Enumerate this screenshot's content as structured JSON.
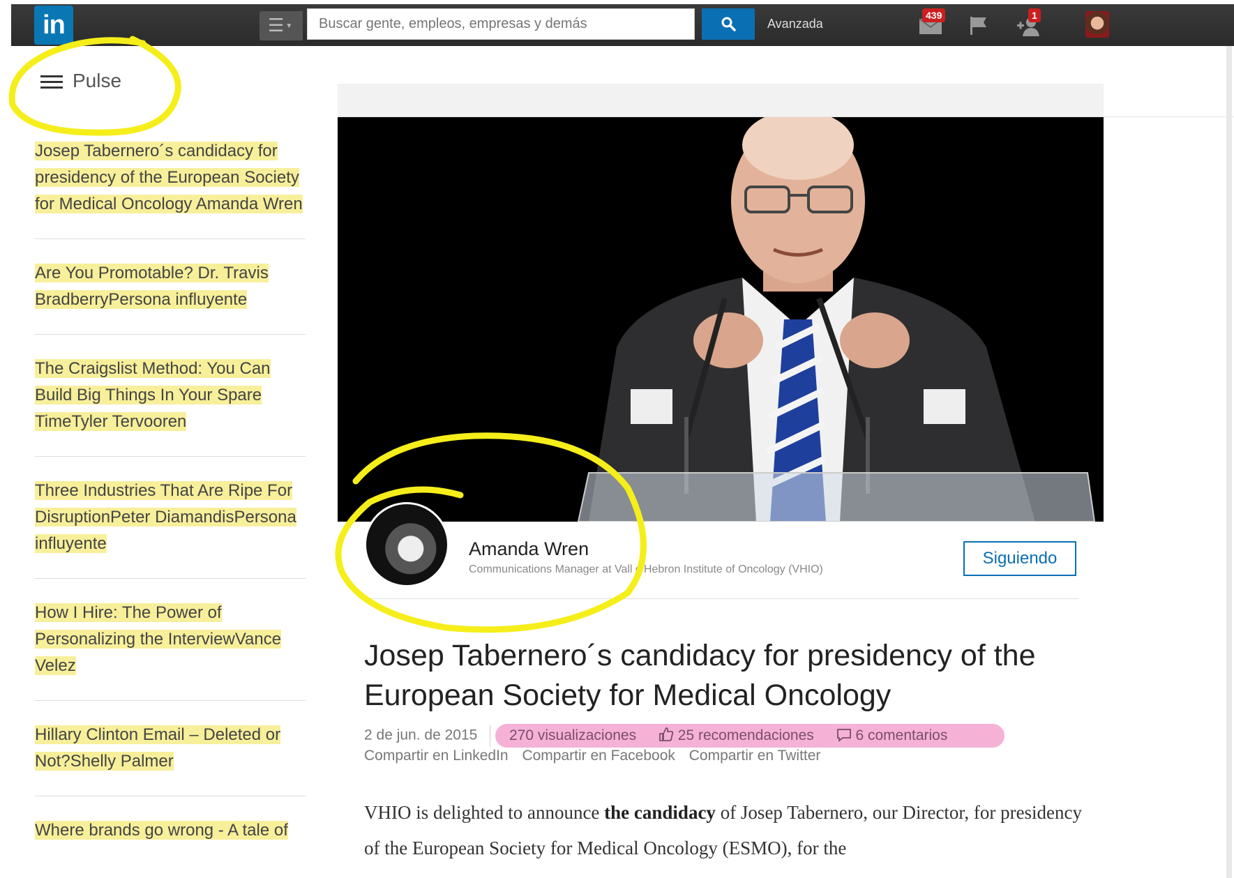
{
  "topbar": {
    "logo_text": "in",
    "search_placeholder": "Buscar gente, empleos, empresas y demás",
    "advanced_label": "Avanzada",
    "messages_count": "439",
    "invites_count": "1"
  },
  "pulse": {
    "title": "Pulse"
  },
  "sidebar": {
    "items": [
      {
        "text": "Josep Tabernero´s candidacy for presidency of the European Society for Medical Oncology Amanda Wren"
      },
      {
        "text": "Are You Promotable? Dr. Travis BradberryPersona influyente"
      },
      {
        "text": "The Craigslist Method: You Can Build Big Things In Your Spare TimeTyler Tervooren"
      },
      {
        "text": "Three Industries That Are Ripe For DisruptionPeter DiamandisPersona influyente"
      },
      {
        "text": "How I Hire: The Power of Personalizing the InterviewVance Velez"
      },
      {
        "text": "Hillary Clinton Email – Deleted or Not?Shelly Palmer"
      },
      {
        "text": "Where brands go wrong - A tale of"
      }
    ]
  },
  "author": {
    "name": "Amanda Wren",
    "title": "Communications Manager at Vall d'Hebron Institute of Oncology (VHIO)",
    "follow_label": "Siguiendo"
  },
  "article": {
    "title": "Josep Tabernero´s candidacy for presidency of the European Society for Medical Oncology",
    "date": "2 de jun. de 2015",
    "views": "270 visualizaciones",
    "likes": "25 recomendaciones",
    "comments": "6 comentarios",
    "share_linkedin": "Compartir en LinkedIn",
    "share_facebook": "Compartir en Facebook",
    "share_twitter": "Compartir en Twitter",
    "body_1": "VHIO is delighted to announce ",
    "body_bold": "the candidacy",
    "body_2": " of Josep Tabernero, our Director, for presidency of the European Society for Medical Oncology (ESMO), for the"
  },
  "colors": {
    "linkedin_blue": "#0b6fb3",
    "highlight_yellow": "#f7ef9a",
    "annotation_yellow": "#f5ee1a",
    "annotation_pink": "#f5a3cf"
  }
}
